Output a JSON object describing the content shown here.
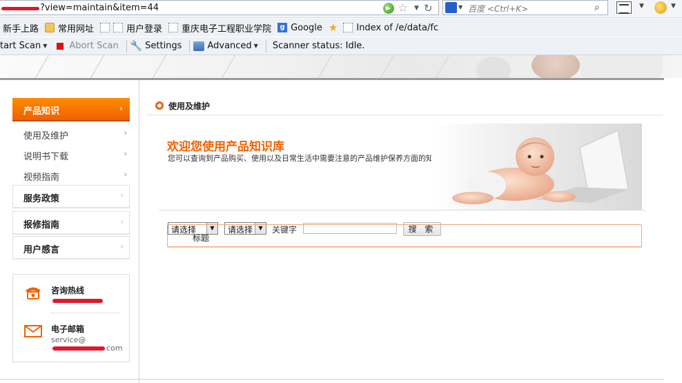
{
  "browser": {
    "url_text": "?view=maintain&item=44",
    "search_placeholder": "百度 <Ctrl+K>",
    "bookmarks": [
      {
        "label": "新手上路",
        "icon": "none"
      },
      {
        "label": "常用网址",
        "icon": "folder-icon"
      },
      {
        "label": "用户登录",
        "icon": "page-icon"
      },
      {
        "label": "重庆电子工程职业学院",
        "icon": "page-icon"
      },
      {
        "label": "Google",
        "icon": "google-icon"
      },
      {
        "label": "Index of /e/data/fc",
        "icon": "page-icon"
      }
    ],
    "scanner": {
      "start_label": "tart Scan",
      "abort_label": "Abort Scan",
      "settings_label": "Settings",
      "advanced_label": "Advanced",
      "status_text": "Scanner status: Idle."
    }
  },
  "sidebar": {
    "active_section": "产品知识",
    "sub_items": [
      "使用及维护",
      "说明书下载",
      "视频指南"
    ],
    "sections": [
      "服务政策",
      "报修指南",
      "用户感言"
    ],
    "contact": {
      "hotline_title": "咨询热线",
      "email_title": "电子邮箱",
      "email_prefix": "service@",
      "email_suffix": "com"
    }
  },
  "main": {
    "crumb_title": "使用及维护",
    "hero_title": "欢迎您使用产品知识库",
    "hero_subtitle": "您可以查询到产品购买、使用以及日常生活中需要注意的产品维护保养方面的知识。",
    "select1_value": "请选择",
    "select2_value": "请选择",
    "keyword_label": "关键字",
    "search_button": "搜 索",
    "result_header": "标题"
  },
  "colors": {
    "accent": "#f06100",
    "redaction": "#e0182d"
  }
}
